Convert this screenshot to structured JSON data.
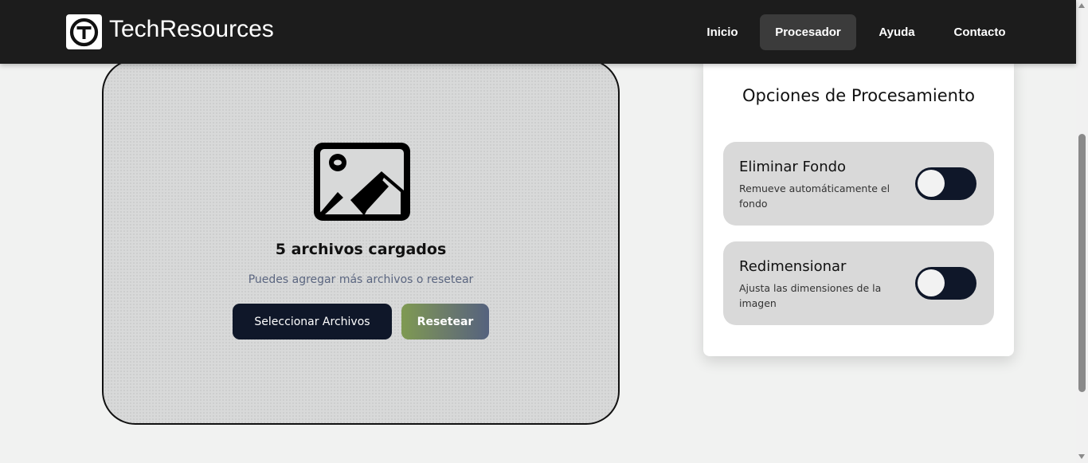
{
  "header": {
    "brand": "TechResources",
    "nav": [
      {
        "label": "Inicio"
      },
      {
        "label": "Procesador",
        "active": true
      },
      {
        "label": "Ayuda"
      },
      {
        "label": "Contacto"
      }
    ]
  },
  "upload": {
    "icon": "image-icon",
    "title": "5 archivos cargados",
    "subtitle": "Puedes agregar más archivos o resetear",
    "select_label": "Seleccionar Archivos",
    "reset_label": "Resetear"
  },
  "options": {
    "title": "Opciones de Procesamiento",
    "items": [
      {
        "label": "Eliminar Fondo",
        "description": "Remueve automáticamente el fondo",
        "enabled": false
      },
      {
        "label": "Redimensionar",
        "description": "Ajusta las dimensiones de la imagen",
        "enabled": false
      }
    ]
  },
  "colors": {
    "header_bg": "#1c1c1c",
    "primary_dark": "#0f1729",
    "nav_active_bg": "#3b3b3b",
    "reset_gradient_start": "#7f9a52",
    "reset_gradient_end": "#55627e"
  }
}
